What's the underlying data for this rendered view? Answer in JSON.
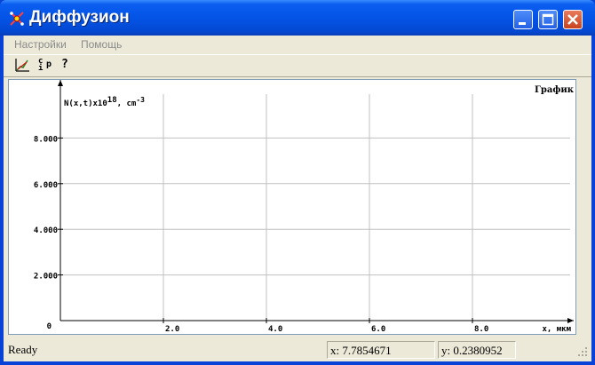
{
  "window": {
    "title": "Диффузион",
    "icon": "app-diffusion-icon",
    "controls": [
      "minimize-icon",
      "maximize-icon",
      "close-icon"
    ]
  },
  "menu": {
    "items": [
      "Настройки",
      "Помощь"
    ]
  },
  "toolbar": {
    "tools": [
      "graph-axes-icon",
      "cip-icon",
      "help-question-icon"
    ],
    "cip_label": "c",
    "cip_sub": "i",
    "cip_p": "p",
    "help_label": "?"
  },
  "plot": {
    "corner_label": "График",
    "y_label_prefix": "N(x,t)x10",
    "y_label_exp": "18",
    "y_label_unit": ", cm",
    "y_label_unit_exp": "-3",
    "x_label": "x, мкм",
    "origin_label": "0",
    "y_ticks": [
      "8.000",
      "6.000",
      "4.000",
      "2.000"
    ],
    "x_ticks": [
      "2.0",
      "4.0",
      "6.0",
      "8.0"
    ],
    "grid": true
  },
  "chart_data": {
    "type": "line",
    "title": "",
    "xlabel": "x, мкм",
    "ylabel": "N(x,t)x10^18, cm^-3",
    "x_ticks": [
      2.0,
      4.0,
      6.0,
      8.0
    ],
    "y_ticks": [
      2.0,
      4.0,
      6.0,
      8.0
    ],
    "series": []
  },
  "status": {
    "text": "Ready",
    "x_label": "x: 7.7854671",
    "y_label": "y: 0.2380952"
  },
  "colors": {
    "titlebar": "#0454e6",
    "frame": "#ece9d8",
    "grid": "#c0c0c0",
    "close_button": "#c9431f"
  }
}
